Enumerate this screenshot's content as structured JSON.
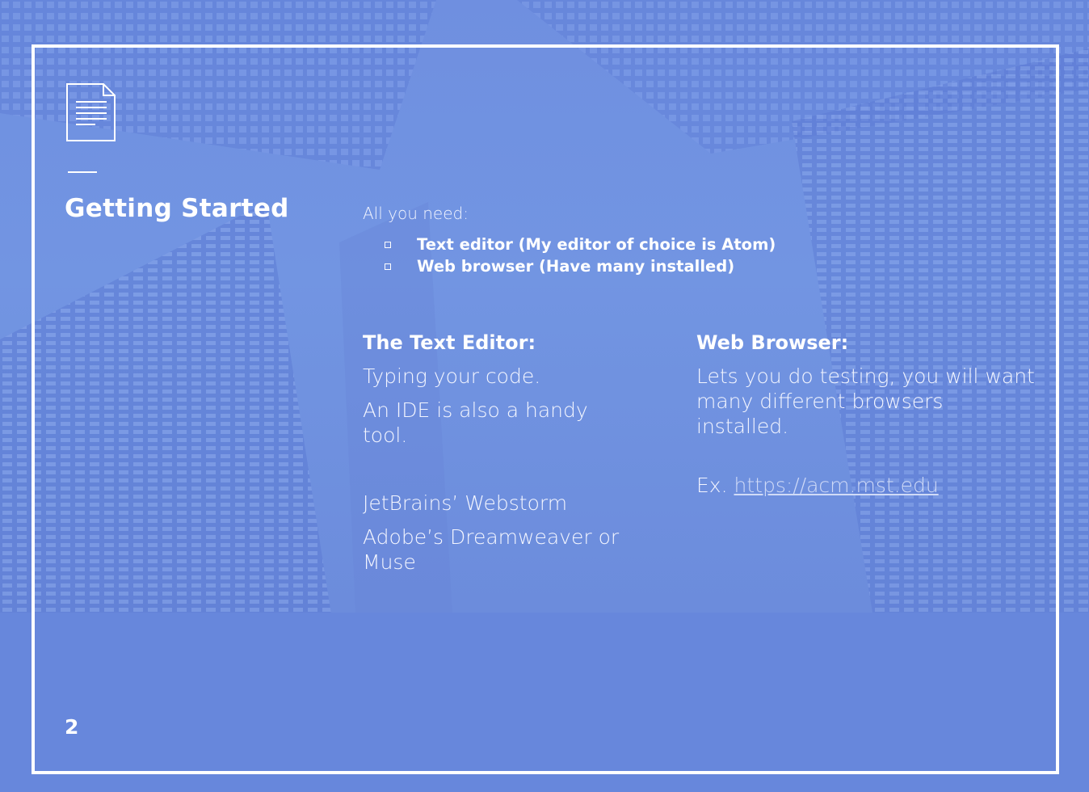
{
  "slide": {
    "title": "Getting Started",
    "intro": "All you need:",
    "bullets": [
      "Text editor (My editor of choice is Atom)",
      "Web browser (Have many installed)"
    ],
    "left_column": {
      "heading": "The Text Editor:",
      "lines": [
        "Typing your code.",
        "An IDE is also a handy tool.",
        "JetBrains’ Webstorm",
        "Adobe’s Dreamweaver or Muse"
      ]
    },
    "right_column": {
      "heading": "Web Browser:",
      "description": "Lets you do testing, you will want many different browsers installed.",
      "example_prefix": "Ex.",
      "example_link": "https://acm.mst.edu"
    },
    "page_number": "2"
  },
  "icons": {
    "document": "document-icon",
    "bullet": "square-bullet-icon"
  },
  "colors": {
    "background": "#6787dc",
    "text": "#ffffff",
    "link": "#d0dbf7"
  }
}
